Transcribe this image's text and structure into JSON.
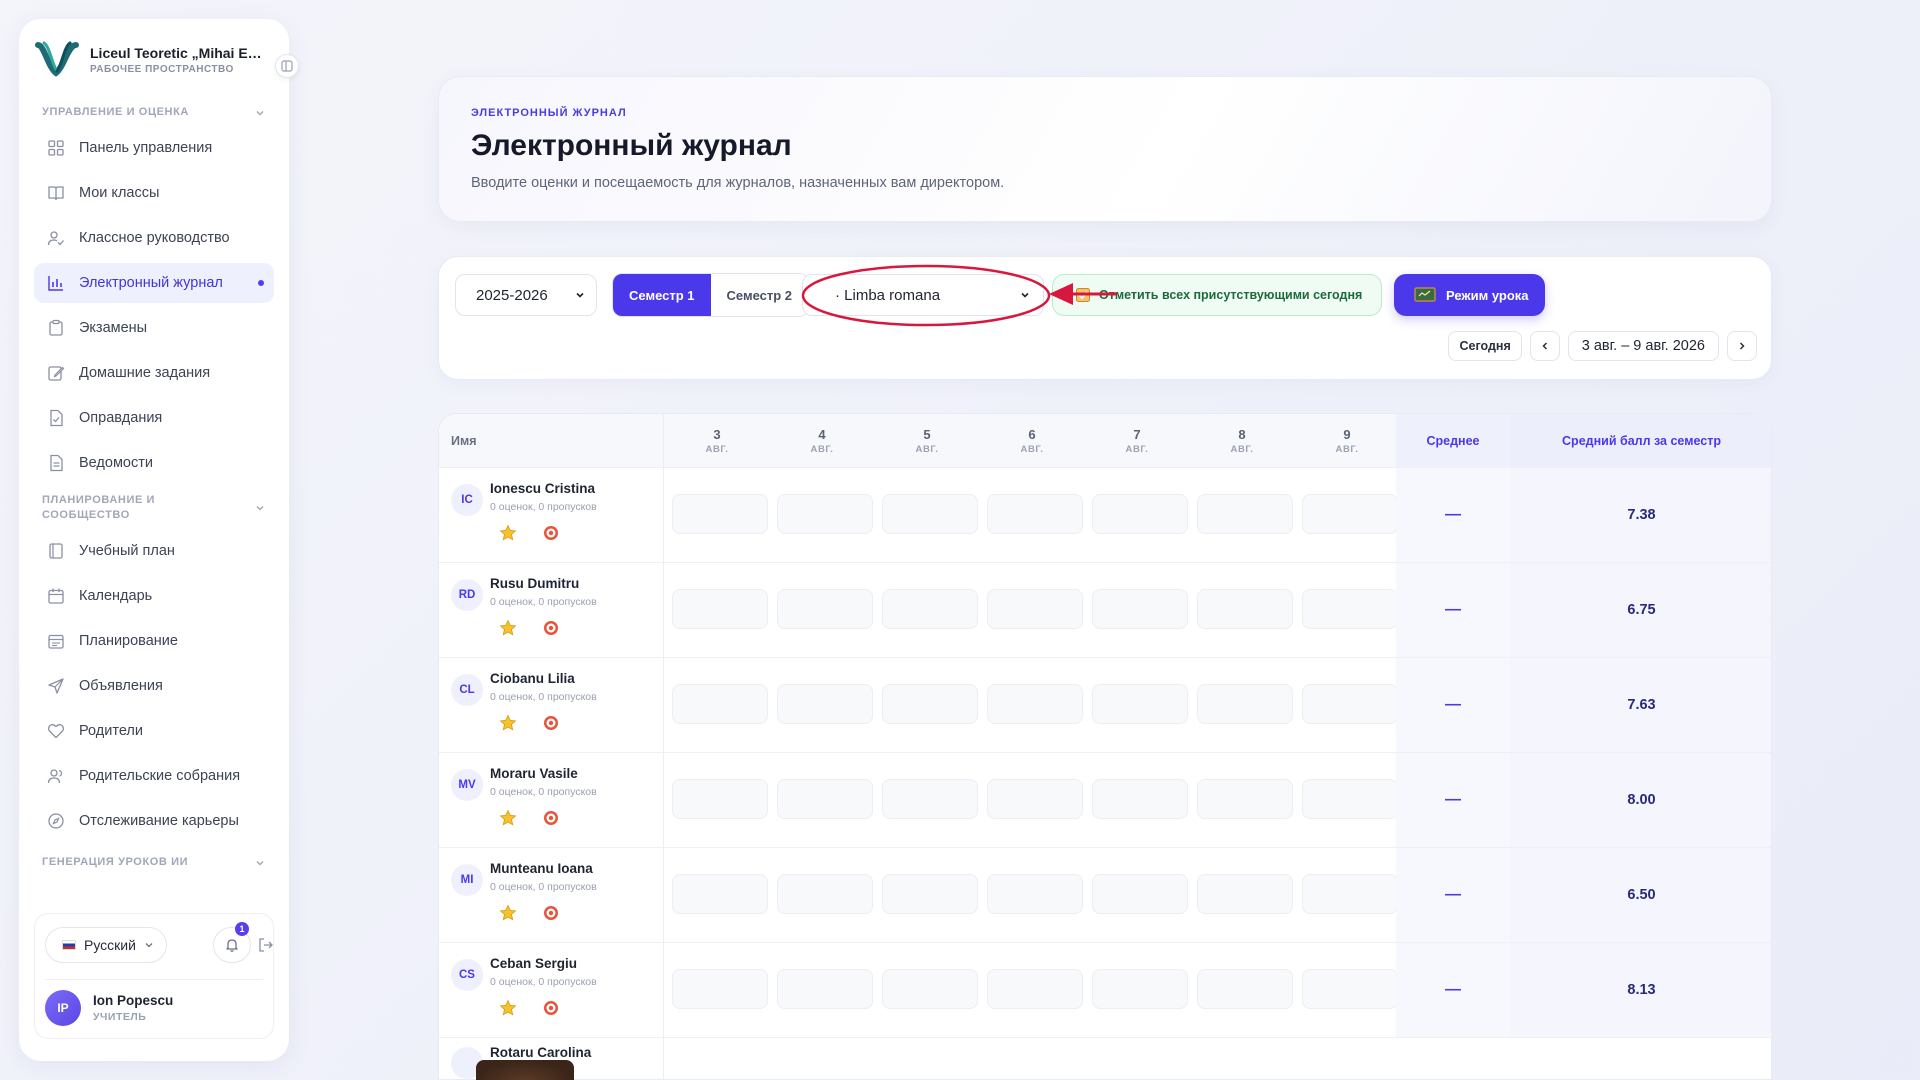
{
  "sidebar": {
    "brand_name": "Liceul Teoretic „Mihai Emi...",
    "brand_sub": "РАБОЧЕЕ ПРОСТРАНСТВО",
    "sections": {
      "s1": "УПРАВЛЕНИЕ И ОЦЕНКА",
      "s2": "ПЛАНИРОВАНИЕ И СООБЩЕСТВО",
      "s3": "ГЕНЕРАЦИЯ УРОКОВ ИИ"
    },
    "items": [
      {
        "label": "Панель управления",
        "icon": "grid-icon"
      },
      {
        "label": "Мои классы",
        "icon": "book-icon"
      },
      {
        "label": "Классное руководство",
        "icon": "user-check-icon"
      },
      {
        "label": "Электронный журнал",
        "icon": "bar-chart-icon",
        "active": true
      },
      {
        "label": "Экзамены",
        "icon": "clipboard-icon"
      },
      {
        "label": "Домашние задания",
        "icon": "edit-icon"
      },
      {
        "label": "Оправдания",
        "icon": "file-check-icon"
      },
      {
        "label": "Ведомости",
        "icon": "file-text-icon"
      },
      {
        "label": "Учебный план",
        "icon": "book-open-icon"
      },
      {
        "label": "Календарь",
        "icon": "calendar-icon"
      },
      {
        "label": "Планирование",
        "icon": "calendar-check-icon"
      },
      {
        "label": "Объявления",
        "icon": "send-icon"
      },
      {
        "label": "Родители",
        "icon": "heart-icon"
      },
      {
        "label": "Родительские собрания",
        "icon": "users-icon"
      },
      {
        "label": "Отслеживание карьеры",
        "icon": "compass-icon"
      }
    ],
    "footer": {
      "language": "Русский",
      "notifications_count": "1",
      "user_initials": "IP",
      "user_name": "Ion Popescu",
      "user_role": "УЧИТЕЛЬ"
    }
  },
  "header": {
    "eyebrow": "ЭЛЕКТРОННЫЙ ЖУРНАЛ",
    "title": "Электронный журнал",
    "subtitle": "Вводите оценки и посещаемость для журналов, назначенных вам директором."
  },
  "toolbar": {
    "year": "2025-2026",
    "semester1": "Семестр 1",
    "semester2": "Семестр 2",
    "subject": "· Limba romana",
    "mark_all": "Отметить всех присутствующими сегодня",
    "lesson_mode": "Режим урока",
    "today": "Сегодня",
    "date_range": "3 авг. – 9 авг. 2026"
  },
  "table": {
    "col_name": "Имя",
    "col_avg": "Среднее",
    "col_sem_avg": "Средний балл за семестр",
    "days": [
      {
        "d": "3",
        "m": "АВГ."
      },
      {
        "d": "4",
        "m": "АВГ."
      },
      {
        "d": "5",
        "m": "АВГ."
      },
      {
        "d": "6",
        "m": "АВГ."
      },
      {
        "d": "7",
        "m": "АВГ."
      },
      {
        "d": "8",
        "m": "АВГ."
      },
      {
        "d": "9",
        "m": "АВГ."
      }
    ],
    "rows": [
      {
        "initials": "IC",
        "name": "Ionescu Cristina",
        "meta": "0 оценок, 0 пропусков",
        "avg": "—",
        "sem_avg": "7.38"
      },
      {
        "initials": "RD",
        "name": "Rusu Dumitru",
        "meta": "0 оценок, 0 пропусков",
        "avg": "—",
        "sem_avg": "6.75"
      },
      {
        "initials": "CL",
        "name": "Ciobanu Lilia",
        "meta": "0 оценок, 0 пропусков",
        "avg": "—",
        "sem_avg": "7.63"
      },
      {
        "initials": "MV",
        "name": "Moraru Vasile",
        "meta": "0 оценок, 0 пропусков",
        "avg": "—",
        "sem_avg": "8.00"
      },
      {
        "initials": "MI",
        "name": "Munteanu Ioana",
        "meta": "0 оценок, 0 пропусков",
        "avg": "—",
        "sem_avg": "6.50"
      },
      {
        "initials": "CS",
        "name": "Ceban Sergiu",
        "meta": "0 оценок, 0 пропусков",
        "avg": "—",
        "sem_avg": "8.13"
      }
    ],
    "partial_row": {
      "name": "Rotaru Carolina"
    }
  },
  "colors": {
    "accent": "#4a38ea",
    "annotation": "#d8173f",
    "success_bg": "#effbf3"
  }
}
